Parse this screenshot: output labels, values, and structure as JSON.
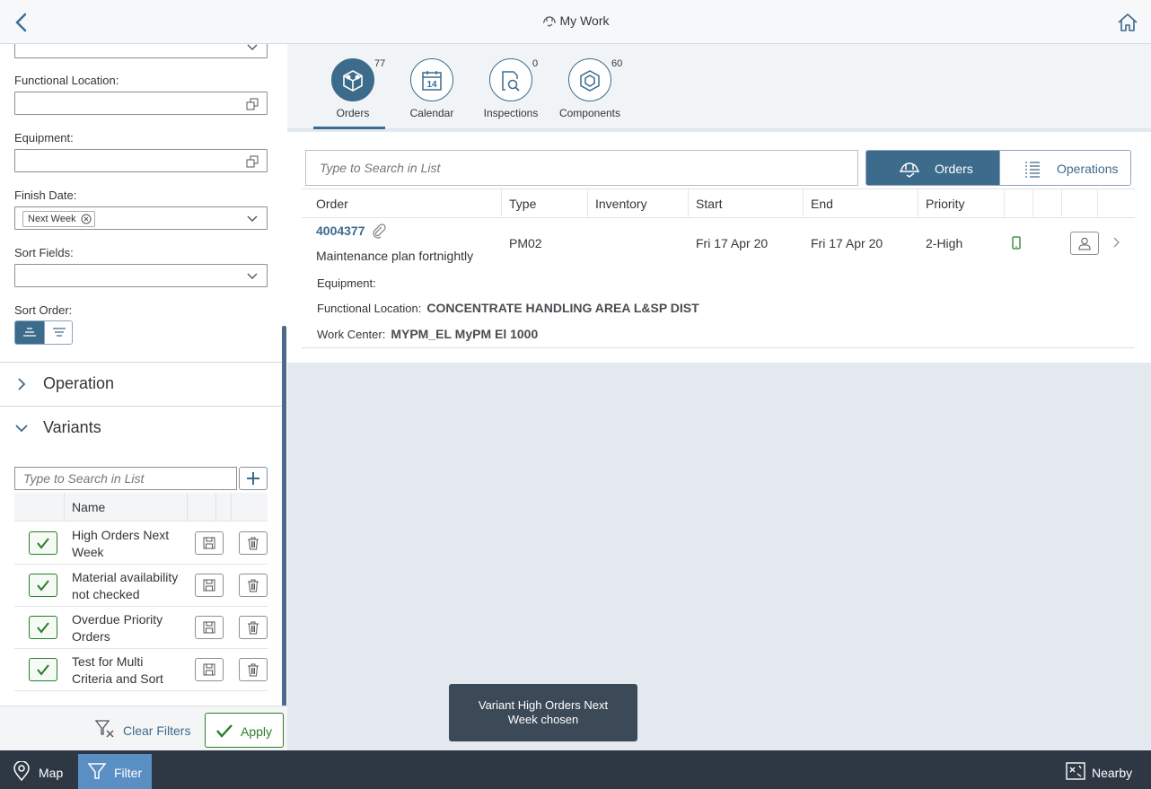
{
  "header": {
    "title": "My Work",
    "back_icon": "chevron-left-icon",
    "home_icon": "home-icon"
  },
  "filters": {
    "functional_location_label": "Functional Location:",
    "equipment_label": "Equipment:",
    "finish_date_label": "Finish Date:",
    "finish_date_token": "Next Week",
    "sort_fields_label": "Sort Fields:",
    "sort_order_label": "Sort Order:",
    "operation_section": "Operation",
    "variants_section": "Variants"
  },
  "variants": {
    "search_placeholder": "Type to Search in List",
    "col_name": "Name",
    "items": [
      {
        "name": "High Orders Next Week",
        "checked": true
      },
      {
        "name": "Material availability not checked",
        "checked": true
      },
      {
        "name": "Overdue Priority Orders",
        "checked": true
      },
      {
        "name": "Test for Multi Criteria and Sort",
        "checked": true
      }
    ]
  },
  "footer": {
    "clear_label": "Clear Filters",
    "apply_label": "Apply"
  },
  "tabs": [
    {
      "label": "Orders",
      "count": "77",
      "icon": "orders-cube-icon"
    },
    {
      "label": "Calendar",
      "count": "",
      "icon": "calendar-icon",
      "calendar_day": "14"
    },
    {
      "label": "Inspections",
      "count": "0",
      "icon": "inspection-icon"
    },
    {
      "label": "Components",
      "count": "60",
      "icon": "component-icon"
    }
  ],
  "list": {
    "search_placeholder": "Type to Search in List",
    "seg_orders": "Orders",
    "seg_operations": "Operations",
    "columns": {
      "order": "Order",
      "type": "Type",
      "inventory": "Inventory",
      "start": "Start",
      "end": "End",
      "priority": "Priority"
    },
    "row": {
      "order_id": "4004377",
      "description": "Maintenance plan fortnightly",
      "type": "PM02",
      "inventory": "",
      "start": "Fri 17 Apr 20",
      "end": "Fri 17 Apr 20",
      "priority": "2-High",
      "equipment_label": "Equipment:",
      "equipment_value": "",
      "func_loc_label": "Functional Location:",
      "func_loc_value": "CONCENTRATE HANDLING AREA L&SP DIST",
      "work_center_label": "Work Center:",
      "work_center_value": "MYPM_EL MyPM El 1000"
    }
  },
  "toast": "Variant High Orders Next Week chosen",
  "bottombar": {
    "map": "Map",
    "filter": "Filter",
    "nearby": "Nearby"
  },
  "colors": {
    "accent": "#3d6b8c",
    "positive": "#2b7d2b",
    "bar": "#2d3844",
    "filter_active": "#5a8fc4"
  }
}
